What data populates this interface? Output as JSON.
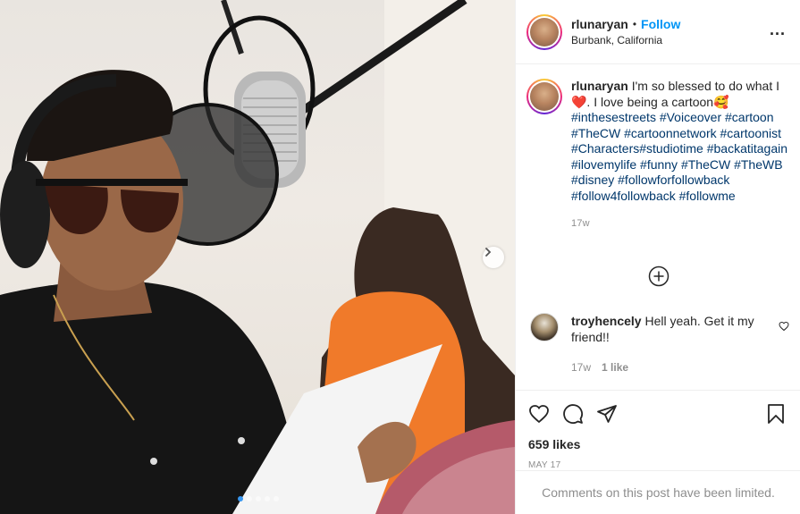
{
  "post": {
    "username": "rlunaryan",
    "separator": "•",
    "follow_label": "Follow",
    "location": "Burbank, California",
    "more_label": "...",
    "caption_text": "I'm so blessed to do what I ❤️. I love being a cartoon🥰",
    "caption_hashtags": "#inthesestreets #Voiceover #cartoon #TheCW #cartoonnetwork #cartoonist #Characters#studiotime #backatitagain #ilovemylife #funny #TheCW #TheWB #disney #followforfollowback #follow4followback #followme",
    "caption_time": "17w",
    "likes": "659 likes",
    "date": "MAY 17",
    "comments_limited": "Comments on this post have been limited."
  },
  "comments": [
    {
      "username": "troyhencely",
      "text": "Hell yeah. Get it my friend!!",
      "time": "17w",
      "likes": "1 like"
    }
  ],
  "carousel": {
    "count": 5,
    "active_index": 0
  },
  "icons": {
    "next": "chevron-right-icon",
    "load_more": "plus-circle-icon",
    "like": "heart-icon",
    "comment": "comment-icon",
    "share": "share-icon",
    "save": "bookmark-icon",
    "options": "more-icon"
  },
  "colors": {
    "follow": "#0095f6",
    "hashtag": "#00376b",
    "muted": "#8e8e8e"
  }
}
